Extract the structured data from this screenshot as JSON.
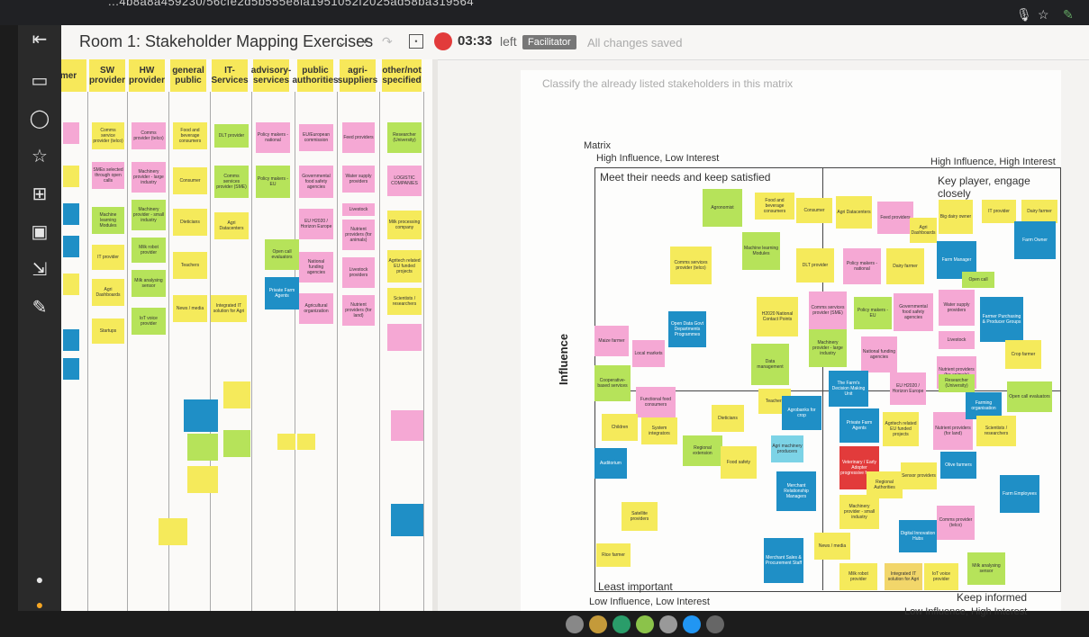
{
  "browser": {
    "url": "...4b8a8a459230/56cfe2d5b555e8ia1951052f2025ad58ba319564"
  },
  "header": {
    "room_title": "Room 1:  Stakeholder Mapping Exercises",
    "timer": "03:33",
    "timer_suffix": "left",
    "facilitator": "Facilitator",
    "saved": "All changes saved"
  },
  "columns": {
    "headers": [
      "mer",
      "SW provider",
      "HW provider",
      "general public",
      "IT-Services",
      "advisory-services",
      "public authorities",
      "agri-suppliers",
      "other/not specified"
    ]
  },
  "matrix": {
    "instruction": "Classify the already listed  stakeholders in this matrix",
    "label": "Matrix",
    "top_left_axis": "High Influence, Low Interest",
    "top_right_axis": "High Influence, High Interest",
    "bottom_left_axis": "Low Influence, Low Interest",
    "bottom_right_axis": "Low Influence, High Interest",
    "q_top_left": "Meet their needs and keep satisfied",
    "q_top_right": "Key player, engage closely",
    "q_bottom_left": "Least important",
    "q_bottom_right": "Keep informed",
    "influence": "Influence"
  },
  "notes": {
    "c1": [
      "Comms service provider (telco)",
      "SMEs selected through open calls",
      "Machine learning Modules",
      "IT provider",
      "Agri Dashboards",
      "Startups"
    ],
    "c2": [
      "Comms provider (telco)",
      "Machinery provider - large industry",
      "Machinery provider - small industry",
      "Milk robot provider",
      "Milk analysing sensor",
      "loT voice provider"
    ],
    "c3": [
      "Food and beverage consumers",
      "Consumer",
      "Dieticians",
      "Teachers",
      "News / media"
    ],
    "c4": [
      "DLT provider",
      "Comms services provider (SME)",
      "Agri Datacenters",
      "Integrated IT solution for Agri"
    ],
    "c5": [
      "Policy makers - national",
      "Policy makers - EU",
      "Open call evaluators",
      "Private Farm Agents"
    ],
    "c6": [
      "EU/European commission",
      "Governmental food safety agencies",
      "EU H2020 / Horizon Europe",
      "National funding agencies",
      "Agricultural organization"
    ],
    "c7": [
      "Feed providers",
      "Water supply providers",
      "Livestock",
      "Nutrient providers (for animals)",
      "Livestock providers",
      "Nutrient providers (for land)"
    ],
    "c8": [
      "Researcher (University)",
      "LOGISTIC COMPANIES",
      "Milk processing company",
      "Agritech related EU funded projects",
      "Scientists / researchers"
    ],
    "m": [
      "Agronomist",
      "Food and beverage consumers",
      "Consumer",
      "Agri Datacenters",
      "Feed providers",
      "Agri Dashboards",
      "Big dairy owner",
      "IT provider",
      "Dairy farmer",
      "Comms services provider (telco)",
      "Machine learning Modules",
      "DLT provider",
      "Policy makers - national",
      "Dairy farmer",
      "Farm Owner",
      "Farm Manager",
      "Open call",
      "H2020 National Contact Points",
      "Comms services provider (SME)",
      "Policy makers - EU",
      "Governmental food safety agencies",
      "Water supply providers",
      "Farmer Purchasing & Producer Groups",
      "Open Data Govt Departments Programmes",
      "Maize farmer",
      "Local markets",
      "Data management",
      "Machinery provider - large industry",
      "National funding agencies",
      "Livestock",
      "Crop farmer",
      "Cooperative-based services",
      "Functional food consumers",
      "Teachers",
      "The Farm's Decision Making Unit",
      "EU H2020 / Horizon Europe",
      "Nutrient providers (for animals)",
      "Researcher (University)",
      "Open call evaluators",
      "Children",
      "System integrators",
      "Dieticians",
      "Agrobanks for crop",
      "Private Farm Agents",
      "Agritech related EU funded projects",
      "Nutrient providers (for land)",
      "Farming organisation",
      "Scientists / researchers",
      "Regional extension",
      "Agri machinery producers",
      "Veterinary / Early Adopter progressive farmer",
      "Food safety",
      "Auditorium",
      "Merchant Relationship Managers",
      "Regional Authorities",
      "Sensor providers",
      "Olive farmers",
      "Farm Employees",
      "Satellite providers",
      "Machinery provider - small industry",
      "Digital Innovation Hubs",
      "Comms provider (telco)",
      "Rice farmer",
      "Merchant Sales & Procurement Staff",
      "News / media",
      "Milk robot provider",
      "Integrated IT solution for Agri",
      "IoT voice provider",
      "Milk analysing sensor"
    ]
  }
}
